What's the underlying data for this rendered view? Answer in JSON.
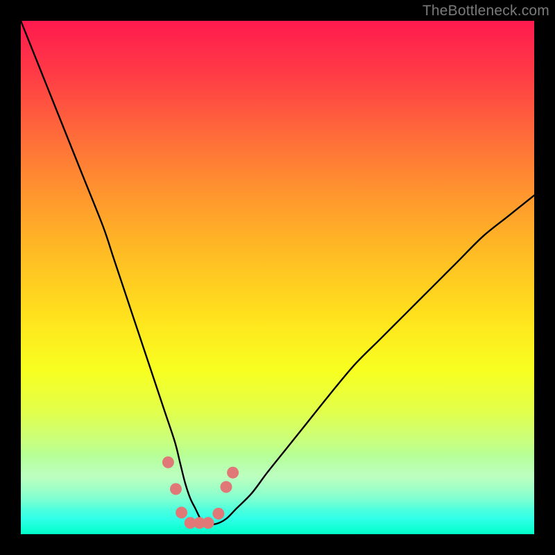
{
  "watermark": {
    "text": "TheBottleneck.com"
  },
  "chart_data": {
    "type": "line",
    "title": "",
    "xlabel": "",
    "ylabel": "",
    "xlim": [
      0,
      100
    ],
    "ylim": [
      0,
      100
    ],
    "grid": false,
    "legend": false,
    "background_gradient": [
      "#ff1a4e",
      "#ffe31d",
      "#00ffc8"
    ],
    "series": [
      {
        "name": "bottleneck-curve",
        "x": [
          0,
          4,
          8,
          12,
          16,
          18,
          20,
          22,
          24,
          26,
          28,
          30,
          31,
          32,
          33,
          34,
          35,
          36,
          38,
          40,
          42,
          45,
          48,
          52,
          56,
          60,
          65,
          70,
          75,
          80,
          85,
          90,
          95,
          100
        ],
        "y": [
          100,
          90,
          80,
          70,
          60,
          54,
          48,
          42,
          36,
          30,
          24,
          18,
          14,
          10,
          7,
          5,
          3,
          2,
          2,
          3,
          5,
          8,
          12,
          17,
          22,
          27,
          33,
          38,
          43,
          48,
          53,
          58,
          62,
          66
        ]
      }
    ],
    "markers": {
      "name": "highlight-dots",
      "color": "#e07878",
      "points": [
        {
          "x": 28.7,
          "y": 14.0
        },
        {
          "x": 30.2,
          "y": 8.8
        },
        {
          "x": 31.3,
          "y": 4.2
        },
        {
          "x": 33.0,
          "y": 2.2
        },
        {
          "x": 34.8,
          "y": 2.2
        },
        {
          "x": 36.5,
          "y": 2.2
        },
        {
          "x": 38.5,
          "y": 4.0
        },
        {
          "x": 40.0,
          "y": 9.2
        },
        {
          "x": 41.3,
          "y": 12.0
        }
      ]
    }
  }
}
